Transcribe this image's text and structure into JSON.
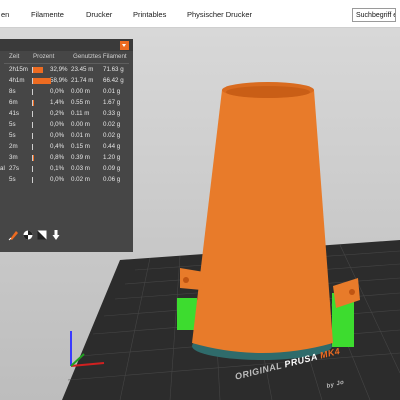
{
  "tabs": [
    "Vorbereiten",
    "Filamente",
    "Drucker",
    "Printables",
    "Physischer Drucker"
  ],
  "tab_visible_text": [
    "en",
    "Filamente",
    "Drucker",
    "Printables",
    "Physischer Drucker"
  ],
  "search": {
    "value": "Suchbegriff e"
  },
  "panel": {
    "columns": {
      "zeit": "Zeit",
      "prozent": "Prozent",
      "filament": "Genutztes Filament"
    },
    "rows": [
      {
        "label": "",
        "zeit": "2h15m",
        "prozent": "32,9%",
        "meter": "23.45 m",
        "gramm": "71.63 g",
        "fraction": 0.329
      },
      {
        "label": "",
        "zeit": "4h1m",
        "prozent": "58,9%",
        "meter": "21.74 m",
        "gramm": "66.42 g",
        "fraction": 0.589
      },
      {
        "label": "",
        "zeit": "8s",
        "prozent": "0,0%",
        "meter": "0.00 m",
        "gramm": "0.01 g",
        "fraction": 0.0
      },
      {
        "label": "",
        "zeit": "6m",
        "prozent": "1,4%",
        "meter": "0.55 m",
        "gramm": "1.67 g",
        "fraction": 0.014
      },
      {
        "label": "",
        "zeit": "41s",
        "prozent": "0,2%",
        "meter": "0.11 m",
        "gramm": "0.33 g",
        "fraction": 0.002
      },
      {
        "label": "",
        "zeit": "5s",
        "prozent": "0,0%",
        "meter": "0.00 m",
        "gramm": "0.02 g",
        "fraction": 0.0
      },
      {
        "label": "",
        "zeit": "5s",
        "prozent": "0,0%",
        "meter": "0.01 m",
        "gramm": "0.02 g",
        "fraction": 0.0
      },
      {
        "label": "",
        "zeit": "2m",
        "prozent": "0,4%",
        "meter": "0.15 m",
        "gramm": "0.44 g",
        "fraction": 0.004
      },
      {
        "label": "",
        "zeit": "3m",
        "prozent": "0,8%",
        "meter": "0.39 m",
        "gramm": "1.20 g",
        "fraction": 0.008
      },
      {
        "label": "al",
        "zeit": "27s",
        "prozent": "0,1%",
        "meter": "0.03 m",
        "gramm": "0.09 g",
        "fraction": 0.001
      },
      {
        "label": "",
        "zeit": "5s",
        "prozent": "0,0%",
        "meter": "0.02 m",
        "gramm": "0.06 g",
        "fraction": 0.0
      }
    ]
  },
  "bed": {
    "brand_prefix": "ORIGINAL ",
    "brand_name": "PRUSA",
    "brand_model": "MK4",
    "brand_sub": "by Jo"
  },
  "colors": {
    "accent": "#ed6b21",
    "model": "#e87b2a",
    "support": "#3ddc2f",
    "bed": "#2b2b2b",
    "panel": "#464646"
  }
}
